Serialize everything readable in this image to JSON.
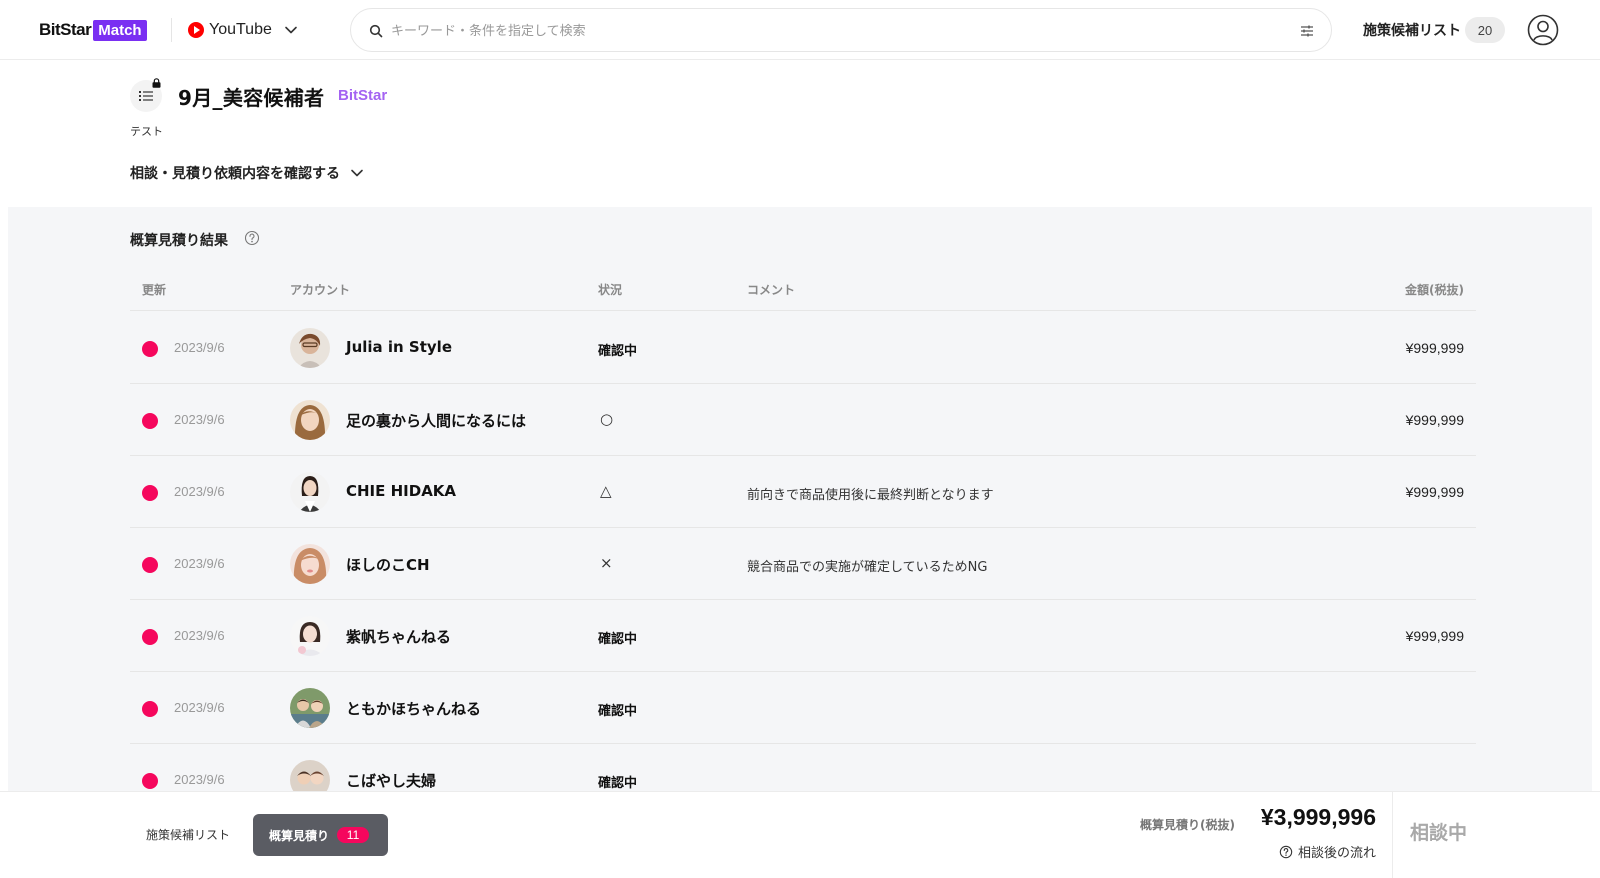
{
  "header": {
    "logo_text": "BitStar",
    "logo_badge": "Match",
    "platform": "YouTube",
    "search_placeholder": "キーワード・条件を指定して検索",
    "candidate_list_label": "施策候補リスト",
    "candidate_count": "20"
  },
  "project": {
    "title": "9月_美容候補者",
    "org": "BitStar",
    "description": "テスト",
    "consult_toggle": "相談・見積り依頼内容を確認する"
  },
  "results": {
    "title": "概算見積り結果",
    "columns": {
      "date": "更新",
      "account": "アカウント",
      "status": "状況",
      "comment": "コメント",
      "amount": "金額(税抜)"
    },
    "rows": [
      {
        "date": "2023/9/6",
        "name": "Julia in Style",
        "status": "確認中",
        "symbol": "",
        "comment": "",
        "amount": "¥999,999"
      },
      {
        "date": "2023/9/6",
        "name": "足の裏から人間になるには",
        "status": "",
        "symbol": "○",
        "comment": "",
        "amount": "¥999,999"
      },
      {
        "date": "2023/9/6",
        "name": "CHIE HIDAKA",
        "status": "",
        "symbol": "△",
        "comment": "前向きで商品使用後に最終判断となります",
        "amount": "¥999,999"
      },
      {
        "date": "2023/9/6",
        "name": "ほしのこCH",
        "status": "",
        "symbol": "×",
        "comment": "競合商品での実施が確定しているためNG",
        "amount": ""
      },
      {
        "date": "2023/9/6",
        "name": "紫帆ちゃんねる",
        "status": "確認中",
        "symbol": "",
        "comment": "",
        "amount": "¥999,999"
      },
      {
        "date": "2023/9/6",
        "name": "ともかほちゃんねる",
        "status": "確認中",
        "symbol": "",
        "comment": "",
        "amount": ""
      },
      {
        "date": "2023/9/6",
        "name": "こばやし夫婦",
        "status": "確認中",
        "symbol": "",
        "comment": "",
        "amount": ""
      }
    ]
  },
  "footer": {
    "tab_candidates": "施策候補リスト",
    "tab_estimate": "概算見積り",
    "estimate_count": "11",
    "total_label": "概算見積り(税抜)",
    "total_value": "¥3,999,996",
    "flow_label": "相談後の流れ",
    "status_label": "相談中"
  },
  "colors": {
    "brand": "#7a2ff2",
    "org_tag": "#a463f2",
    "unread_dot": "#f5075d",
    "panel_bg": "#f5f6f8"
  }
}
